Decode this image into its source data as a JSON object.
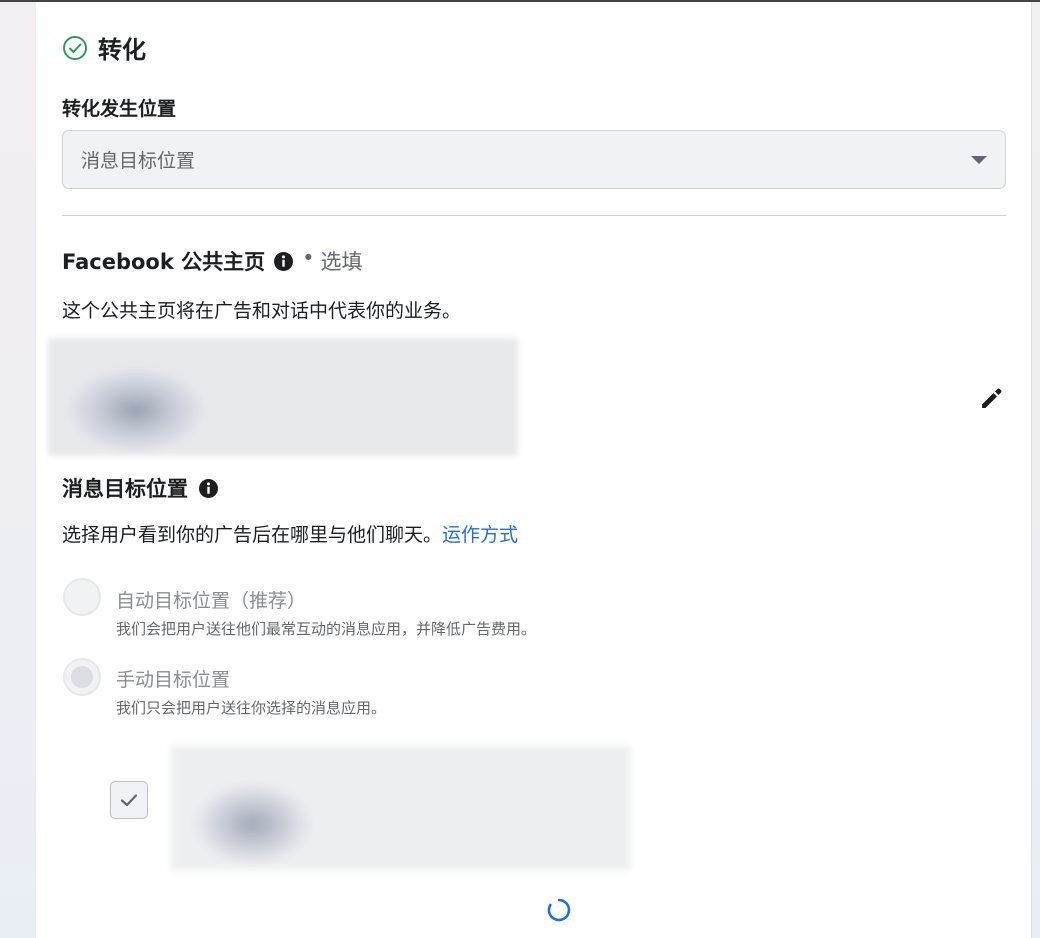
{
  "conversion": {
    "title": "转化",
    "location_label": "转化发生位置",
    "location_value": "消息目标位置"
  },
  "facebook_page": {
    "title": "Facebook 公共主页",
    "optional_sep": "•",
    "optional": "选填",
    "description": "这个公共主页将在广告和对话中代表你的业务。"
  },
  "destination": {
    "title": "消息目标位置",
    "description": "选择用户看到你的广告后在哪里与他们聊天。",
    "link": "运作方式",
    "options": [
      {
        "title": "自动目标位置（推荐）",
        "subtitle": "我们会把用户送往他们最常互动的消息应用，并降低广告费用。",
        "selected": false
      },
      {
        "title": "手动目标位置",
        "subtitle": "我们只会把用户送往你选择的消息应用。",
        "selected": true
      }
    ]
  },
  "colors": {
    "link": "#216fdb",
    "success": "#2d9b57"
  }
}
